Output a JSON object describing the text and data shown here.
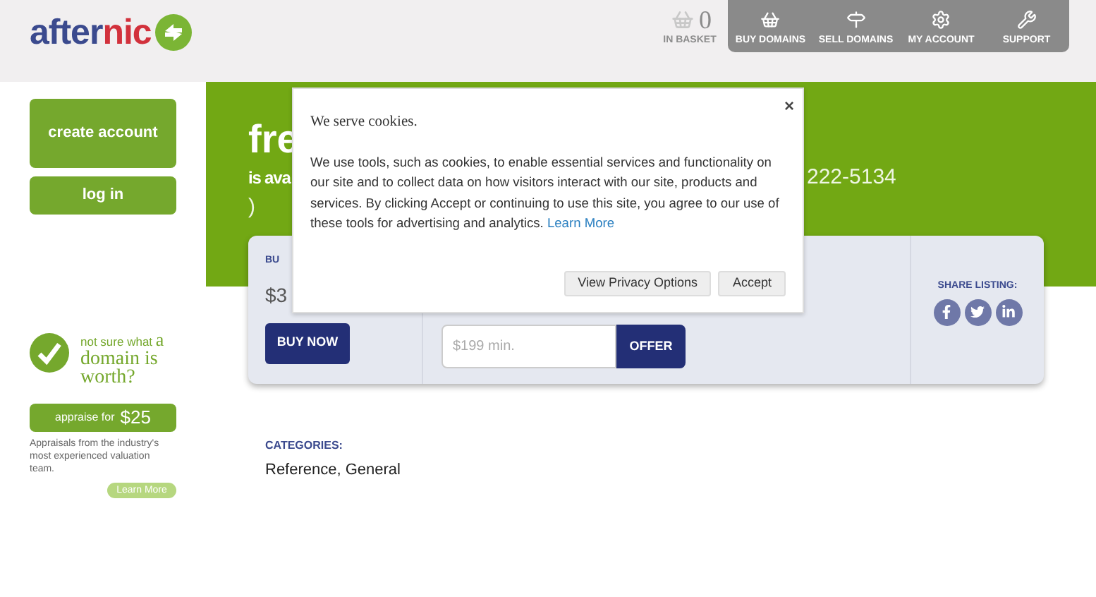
{
  "header": {
    "logo": {
      "part_1": "after",
      "part_2": "nic"
    },
    "basket": {
      "count": "0",
      "label": "IN BASKET"
    },
    "nav": [
      {
        "label": "BUY DOMAINS",
        "kind": "basket"
      },
      {
        "label": "SELL DOMAINS",
        "kind": "sign"
      },
      {
        "label": "MY ACCOUNT",
        "kind": "gears"
      },
      {
        "label": "SUPPORT",
        "kind": "wrench"
      }
    ]
  },
  "sidebar": {
    "create_account": "create account",
    "log_in": "log in",
    "appraise": {
      "line_1": "not sure what",
      "line_1_end": "a",
      "line_2": "domain is",
      "line_3": "worth?",
      "button_prefix": "appraise for",
      "button_price": "$25",
      "description": "Appraisals from the industry's most experienced valuation team.",
      "learn_more": "Learn More"
    }
  },
  "hero": {
    "title": "fre",
    "subtitle": "is ava",
    "phone": "222-5134",
    "paren": ")"
  },
  "listing": {
    "buy_label": "BU",
    "price": "$3",
    "buy_button": "BUY NOW",
    "offer_placeholder": "$199 min.",
    "offer_button": "OFFER",
    "share_label": "SHARE LISTING:",
    "share": [
      {
        "kind": "facebook"
      },
      {
        "kind": "twitter"
      },
      {
        "kind": "linkedin"
      }
    ]
  },
  "categories": {
    "label": "CATEGORIES:",
    "value": "Reference, General"
  },
  "cookie_dialog": {
    "title": "We serve cookies.",
    "body": "We use tools, such as cookies, to enable essential services and functionality on our site and to collect data on how visitors interact with our site, products and services. By clicking Accept or continuing to use this site, you agree to our use of these tools for advertising and analytics.",
    "link": "Learn More",
    "close": "×",
    "buttons": [
      "View Privacy Options",
      "Accept"
    ]
  }
}
